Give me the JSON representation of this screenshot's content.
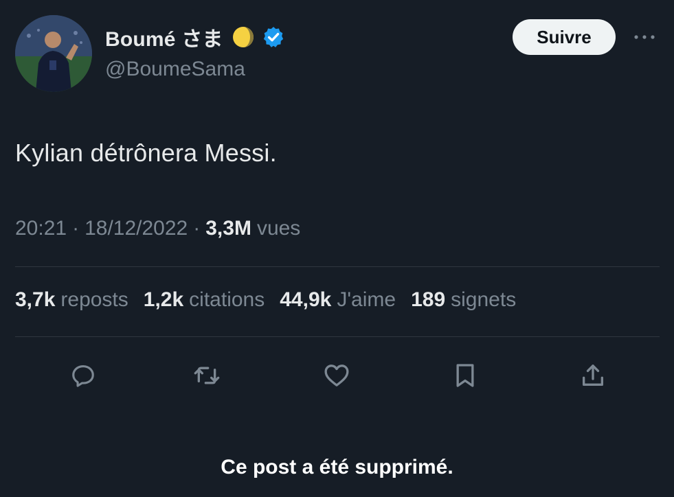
{
  "author": {
    "display_name": "Boumé さま",
    "handle": "@BoumeSama"
  },
  "header": {
    "follow_label": "Suivre"
  },
  "post": {
    "text": "Kylian détrônera Messi.",
    "time": "20:21",
    "date": "18/12/2022",
    "views_count": "3,3M",
    "views_label": "vues",
    "separator": "·"
  },
  "stats": [
    {
      "count": "3,7k",
      "label": "reposts"
    },
    {
      "count": "1,2k",
      "label": "citations"
    },
    {
      "count": "44,9k",
      "label": "J'aime"
    },
    {
      "count": "189",
      "label": "signets"
    }
  ],
  "actions": [
    {
      "name": "reply",
      "icon": "reply-icon"
    },
    {
      "name": "repost",
      "icon": "repost-icon"
    },
    {
      "name": "like",
      "icon": "heart-icon"
    },
    {
      "name": "bookmark",
      "icon": "bookmark-icon"
    },
    {
      "name": "share",
      "icon": "share-icon"
    }
  ],
  "notice": "Ce post a été supprimé.",
  "colors": {
    "background": "#161d26",
    "primary_text": "#e7e9ea",
    "secondary_text": "#7d8893",
    "verified": "#1d9bf0",
    "moon": "#f5d142",
    "divider": "#2f3740"
  }
}
